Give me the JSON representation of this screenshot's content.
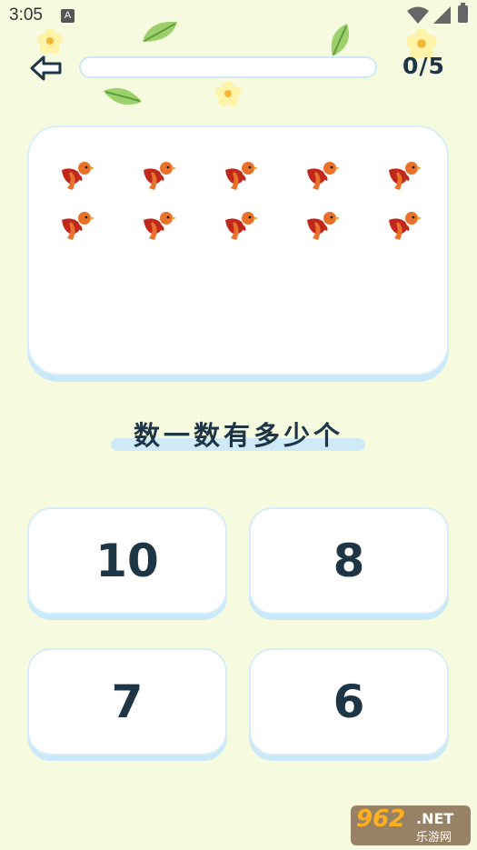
{
  "status_bar": {
    "time": "3:05",
    "notification_icon": "A"
  },
  "header": {
    "back_icon": "arrow-left-icon",
    "progress_text": "0/5",
    "progress_fraction": 0
  },
  "card": {
    "item_icon": "bird-icon",
    "item_count": 10,
    "item_colors": {
      "body": "#c0281c",
      "wing": "#e8722a",
      "beak": "#f0a020"
    }
  },
  "question": "数一数有多少个",
  "options": [
    {
      "label": "10"
    },
    {
      "label": "8"
    },
    {
      "label": "7"
    },
    {
      "label": "6"
    }
  ],
  "watermark": {
    "logo": "962",
    "net": ".NET",
    "subtitle": "乐游网"
  },
  "colors": {
    "background": "#f6fadf",
    "text": "#1e3545",
    "card_shadow": "#c9e9f8"
  }
}
